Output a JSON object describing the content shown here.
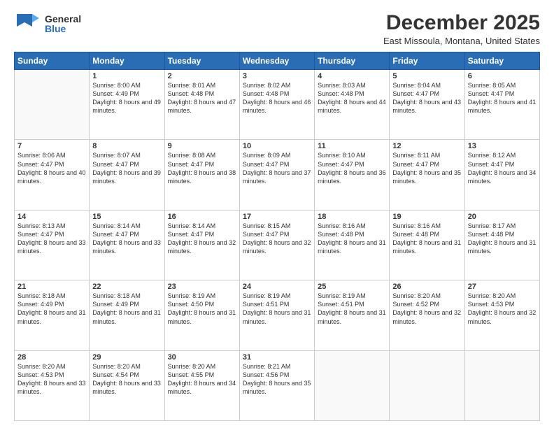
{
  "header": {
    "logo_general": "General",
    "logo_blue": "Blue",
    "month_title": "December 2025",
    "location": "East Missoula, Montana, United States"
  },
  "days_of_week": [
    "Sunday",
    "Monday",
    "Tuesday",
    "Wednesday",
    "Thursday",
    "Friday",
    "Saturday"
  ],
  "weeks": [
    [
      {
        "day": "",
        "empty": true
      },
      {
        "day": "1",
        "sunrise": "Sunrise: 8:00 AM",
        "sunset": "Sunset: 4:49 PM",
        "daylight": "Daylight: 8 hours and 49 minutes."
      },
      {
        "day": "2",
        "sunrise": "Sunrise: 8:01 AM",
        "sunset": "Sunset: 4:48 PM",
        "daylight": "Daylight: 8 hours and 47 minutes."
      },
      {
        "day": "3",
        "sunrise": "Sunrise: 8:02 AM",
        "sunset": "Sunset: 4:48 PM",
        "daylight": "Daylight: 8 hours and 46 minutes."
      },
      {
        "day": "4",
        "sunrise": "Sunrise: 8:03 AM",
        "sunset": "Sunset: 4:48 PM",
        "daylight": "Daylight: 8 hours and 44 minutes."
      },
      {
        "day": "5",
        "sunrise": "Sunrise: 8:04 AM",
        "sunset": "Sunset: 4:47 PM",
        "daylight": "Daylight: 8 hours and 43 minutes."
      },
      {
        "day": "6",
        "sunrise": "Sunrise: 8:05 AM",
        "sunset": "Sunset: 4:47 PM",
        "daylight": "Daylight: 8 hours and 41 minutes."
      }
    ],
    [
      {
        "day": "7",
        "sunrise": "Sunrise: 8:06 AM",
        "sunset": "Sunset: 4:47 PM",
        "daylight": "Daylight: 8 hours and 40 minutes."
      },
      {
        "day": "8",
        "sunrise": "Sunrise: 8:07 AM",
        "sunset": "Sunset: 4:47 PM",
        "daylight": "Daylight: 8 hours and 39 minutes."
      },
      {
        "day": "9",
        "sunrise": "Sunrise: 8:08 AM",
        "sunset": "Sunset: 4:47 PM",
        "daylight": "Daylight: 8 hours and 38 minutes."
      },
      {
        "day": "10",
        "sunrise": "Sunrise: 8:09 AM",
        "sunset": "Sunset: 4:47 PM",
        "daylight": "Daylight: 8 hours and 37 minutes."
      },
      {
        "day": "11",
        "sunrise": "Sunrise: 8:10 AM",
        "sunset": "Sunset: 4:47 PM",
        "daylight": "Daylight: 8 hours and 36 minutes."
      },
      {
        "day": "12",
        "sunrise": "Sunrise: 8:11 AM",
        "sunset": "Sunset: 4:47 PM",
        "daylight": "Daylight: 8 hours and 35 minutes."
      },
      {
        "day": "13",
        "sunrise": "Sunrise: 8:12 AM",
        "sunset": "Sunset: 4:47 PM",
        "daylight": "Daylight: 8 hours and 34 minutes."
      }
    ],
    [
      {
        "day": "14",
        "sunrise": "Sunrise: 8:13 AM",
        "sunset": "Sunset: 4:47 PM",
        "daylight": "Daylight: 8 hours and 33 minutes."
      },
      {
        "day": "15",
        "sunrise": "Sunrise: 8:14 AM",
        "sunset": "Sunset: 4:47 PM",
        "daylight": "Daylight: 8 hours and 33 minutes."
      },
      {
        "day": "16",
        "sunrise": "Sunrise: 8:14 AM",
        "sunset": "Sunset: 4:47 PM",
        "daylight": "Daylight: 8 hours and 32 minutes."
      },
      {
        "day": "17",
        "sunrise": "Sunrise: 8:15 AM",
        "sunset": "Sunset: 4:47 PM",
        "daylight": "Daylight: 8 hours and 32 minutes."
      },
      {
        "day": "18",
        "sunrise": "Sunrise: 8:16 AM",
        "sunset": "Sunset: 4:48 PM",
        "daylight": "Daylight: 8 hours and 31 minutes."
      },
      {
        "day": "19",
        "sunrise": "Sunrise: 8:16 AM",
        "sunset": "Sunset: 4:48 PM",
        "daylight": "Daylight: 8 hours and 31 minutes."
      },
      {
        "day": "20",
        "sunrise": "Sunrise: 8:17 AM",
        "sunset": "Sunset: 4:48 PM",
        "daylight": "Daylight: 8 hours and 31 minutes."
      }
    ],
    [
      {
        "day": "21",
        "sunrise": "Sunrise: 8:18 AM",
        "sunset": "Sunset: 4:49 PM",
        "daylight": "Daylight: 8 hours and 31 minutes."
      },
      {
        "day": "22",
        "sunrise": "Sunrise: 8:18 AM",
        "sunset": "Sunset: 4:49 PM",
        "daylight": "Daylight: 8 hours and 31 minutes."
      },
      {
        "day": "23",
        "sunrise": "Sunrise: 8:19 AM",
        "sunset": "Sunset: 4:50 PM",
        "daylight": "Daylight: 8 hours and 31 minutes."
      },
      {
        "day": "24",
        "sunrise": "Sunrise: 8:19 AM",
        "sunset": "Sunset: 4:51 PM",
        "daylight": "Daylight: 8 hours and 31 minutes."
      },
      {
        "day": "25",
        "sunrise": "Sunrise: 8:19 AM",
        "sunset": "Sunset: 4:51 PM",
        "daylight": "Daylight: 8 hours and 31 minutes."
      },
      {
        "day": "26",
        "sunrise": "Sunrise: 8:20 AM",
        "sunset": "Sunset: 4:52 PM",
        "daylight": "Daylight: 8 hours and 32 minutes."
      },
      {
        "day": "27",
        "sunrise": "Sunrise: 8:20 AM",
        "sunset": "Sunset: 4:53 PM",
        "daylight": "Daylight: 8 hours and 32 minutes."
      }
    ],
    [
      {
        "day": "28",
        "sunrise": "Sunrise: 8:20 AM",
        "sunset": "Sunset: 4:53 PM",
        "daylight": "Daylight: 8 hours and 33 minutes."
      },
      {
        "day": "29",
        "sunrise": "Sunrise: 8:20 AM",
        "sunset": "Sunset: 4:54 PM",
        "daylight": "Daylight: 8 hours and 33 minutes."
      },
      {
        "day": "30",
        "sunrise": "Sunrise: 8:20 AM",
        "sunset": "Sunset: 4:55 PM",
        "daylight": "Daylight: 8 hours and 34 minutes."
      },
      {
        "day": "31",
        "sunrise": "Sunrise: 8:21 AM",
        "sunset": "Sunset: 4:56 PM",
        "daylight": "Daylight: 8 hours and 35 minutes."
      },
      {
        "day": "",
        "empty": true
      },
      {
        "day": "",
        "empty": true
      },
      {
        "day": "",
        "empty": true
      }
    ]
  ]
}
